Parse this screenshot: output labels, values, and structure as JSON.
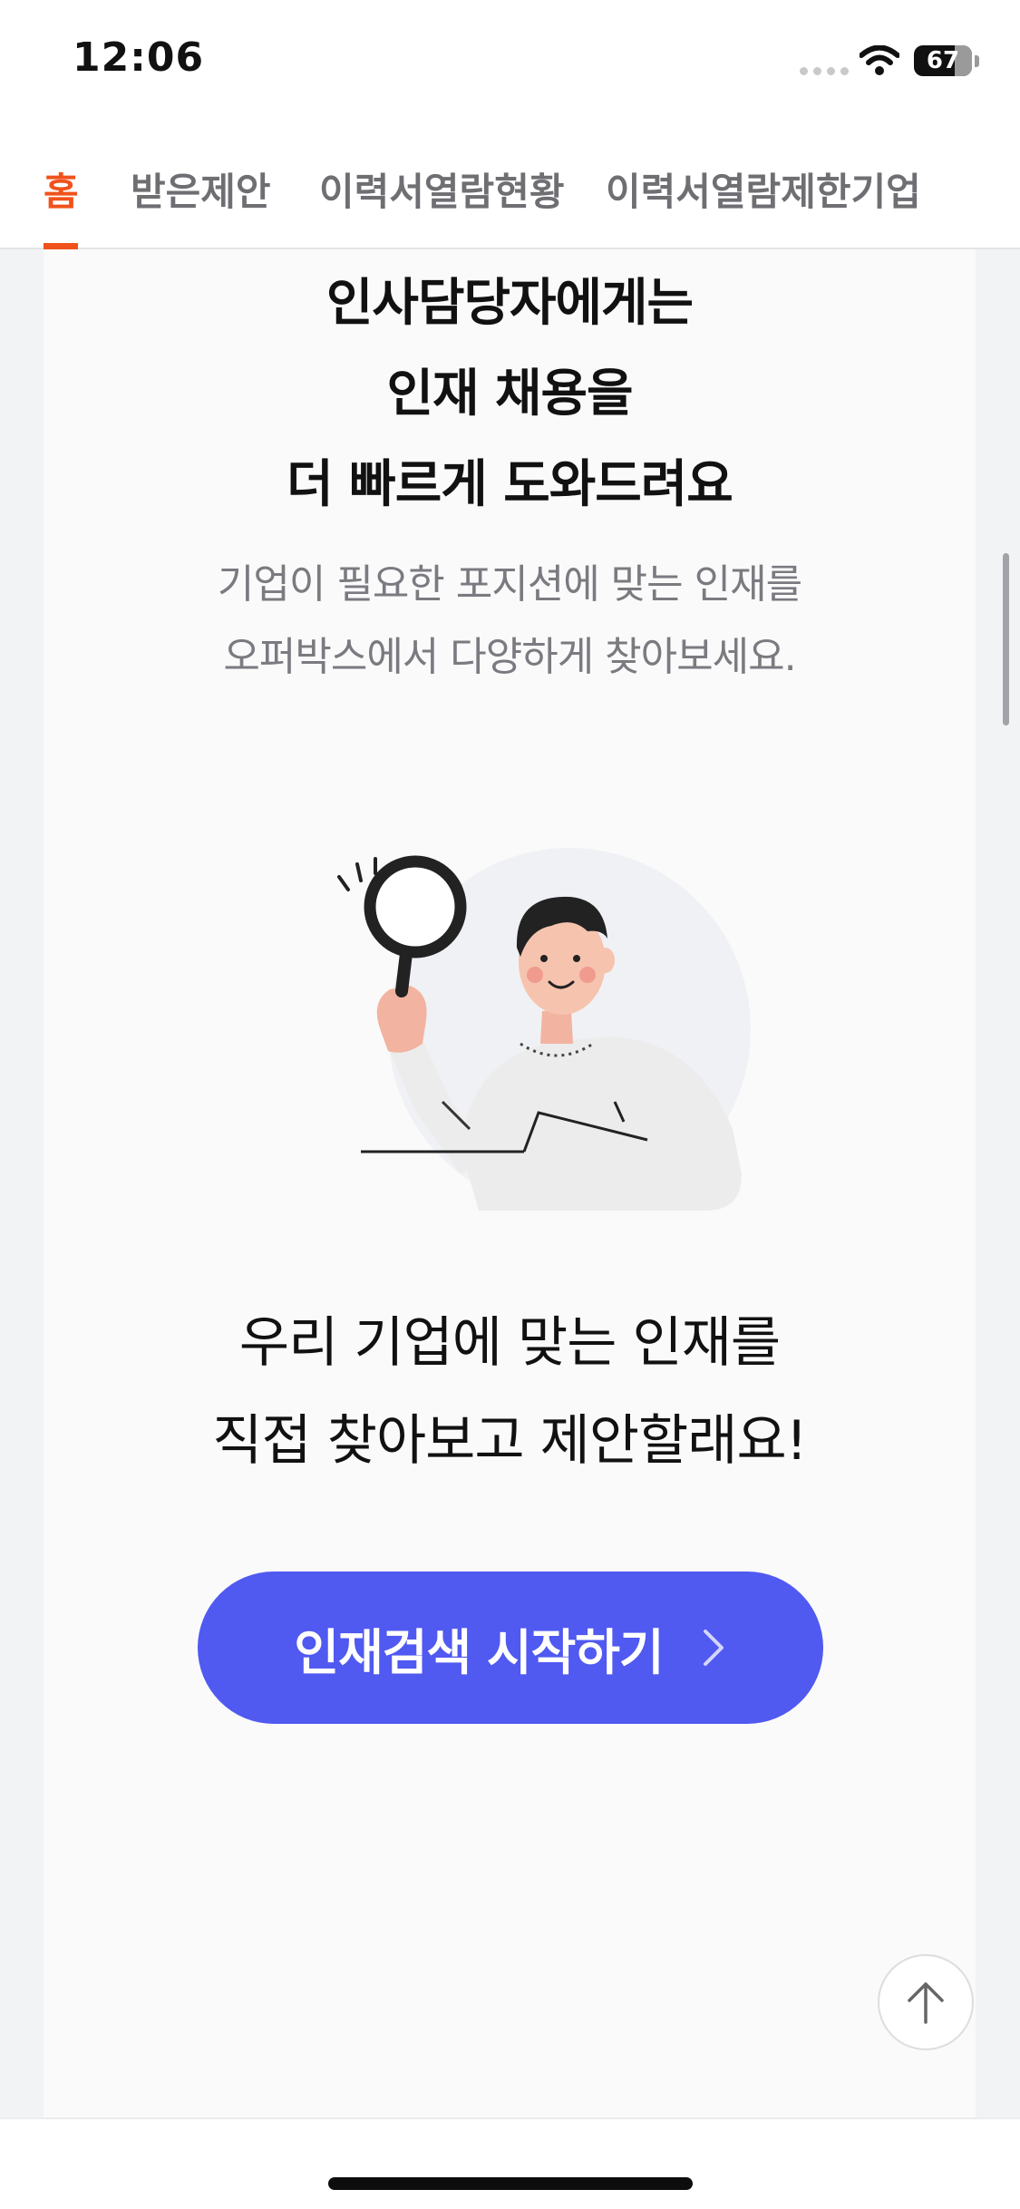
{
  "status_bar": {
    "time": "12:06",
    "battery": "67"
  },
  "tabs": [
    {
      "label": "홈",
      "active": true
    },
    {
      "label": "받은제안",
      "active": false
    },
    {
      "label": "이력서열람현황",
      "active": false
    },
    {
      "label": "이력서열람제한기업",
      "active": false
    }
  ],
  "content": {
    "headline_lines": [
      "인사담당자에게는",
      "인재 채용을",
      "더 빠르게 도와드려요"
    ],
    "sub_lines": [
      "기업이 필요한 포지션에 맞는 인재를",
      "오퍼박스에서 다양하게 찾아보세요."
    ],
    "cta_lines": [
      "우리 기업에 맞는 인재를",
      "직접 찾아보고 제안할래요!"
    ],
    "button_label": "인재검색 시작하기"
  },
  "colors": {
    "accent": "#f0521b",
    "button": "#5059f0"
  },
  "icons": {
    "status": [
      "signal-icon",
      "wifi-icon",
      "battery-icon"
    ],
    "button": "chevron-right-icon",
    "back_to_top": "arrow-up-icon",
    "illustration": "person-with-magnifier-illustration"
  }
}
